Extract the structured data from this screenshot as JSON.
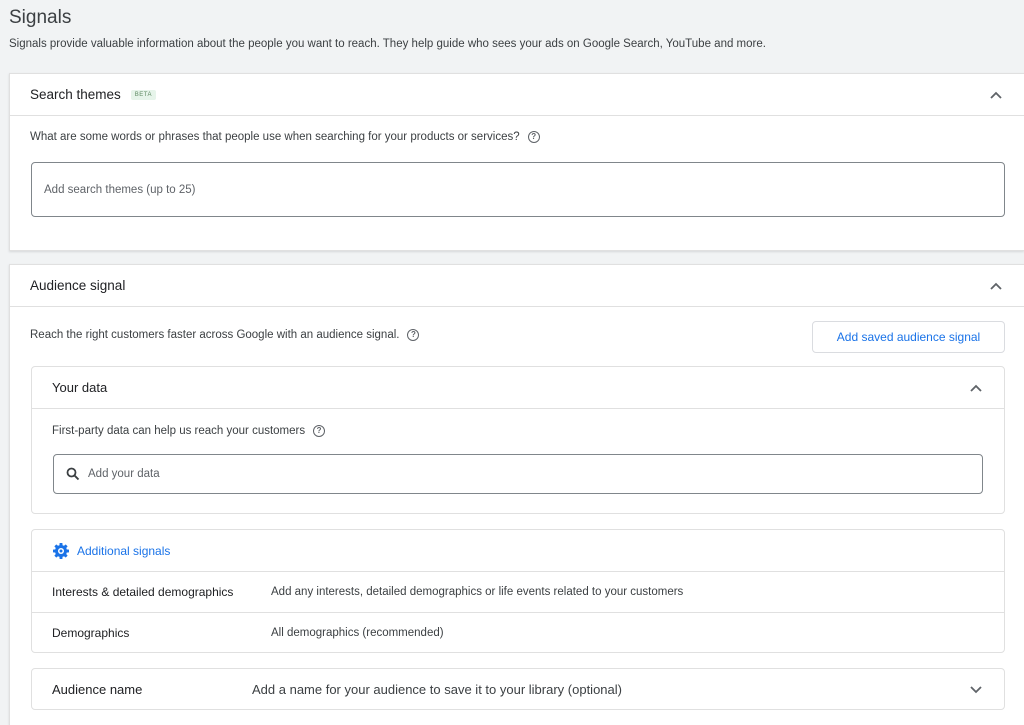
{
  "page": {
    "title": "Signals",
    "description": "Signals provide valuable information about the people you want to reach. They help guide who sees your ads on Google Search, YouTube and more."
  },
  "search_themes": {
    "title": "Search themes",
    "badge": "BETA",
    "question": "What are some words or phrases that people use when searching for your products or services?",
    "input_placeholder": "Add search themes (up to 25)"
  },
  "audience_signal": {
    "title": "Audience signal",
    "description": "Reach the right customers faster across Google with an audience signal.",
    "add_saved_button": "Add saved audience signal",
    "your_data": {
      "title": "Your data",
      "description": "First-party data can help us reach your customers",
      "input_placeholder": "Add your data"
    },
    "additional_signals": {
      "title": "Additional signals",
      "rows": [
        {
          "label": "Interests & detailed demographics",
          "value": "Add any interests, detailed demographics or life events related to your customers"
        },
        {
          "label": "Demographics",
          "value": "All demographics (recommended)"
        }
      ]
    },
    "audience_name": {
      "label": "Audience name",
      "placeholder": "Add a name for your audience to save it to your library (optional)"
    }
  },
  "colors": {
    "accent": "#1a73e8",
    "background": "#f1f3f4",
    "border": "#e0e0e0"
  }
}
